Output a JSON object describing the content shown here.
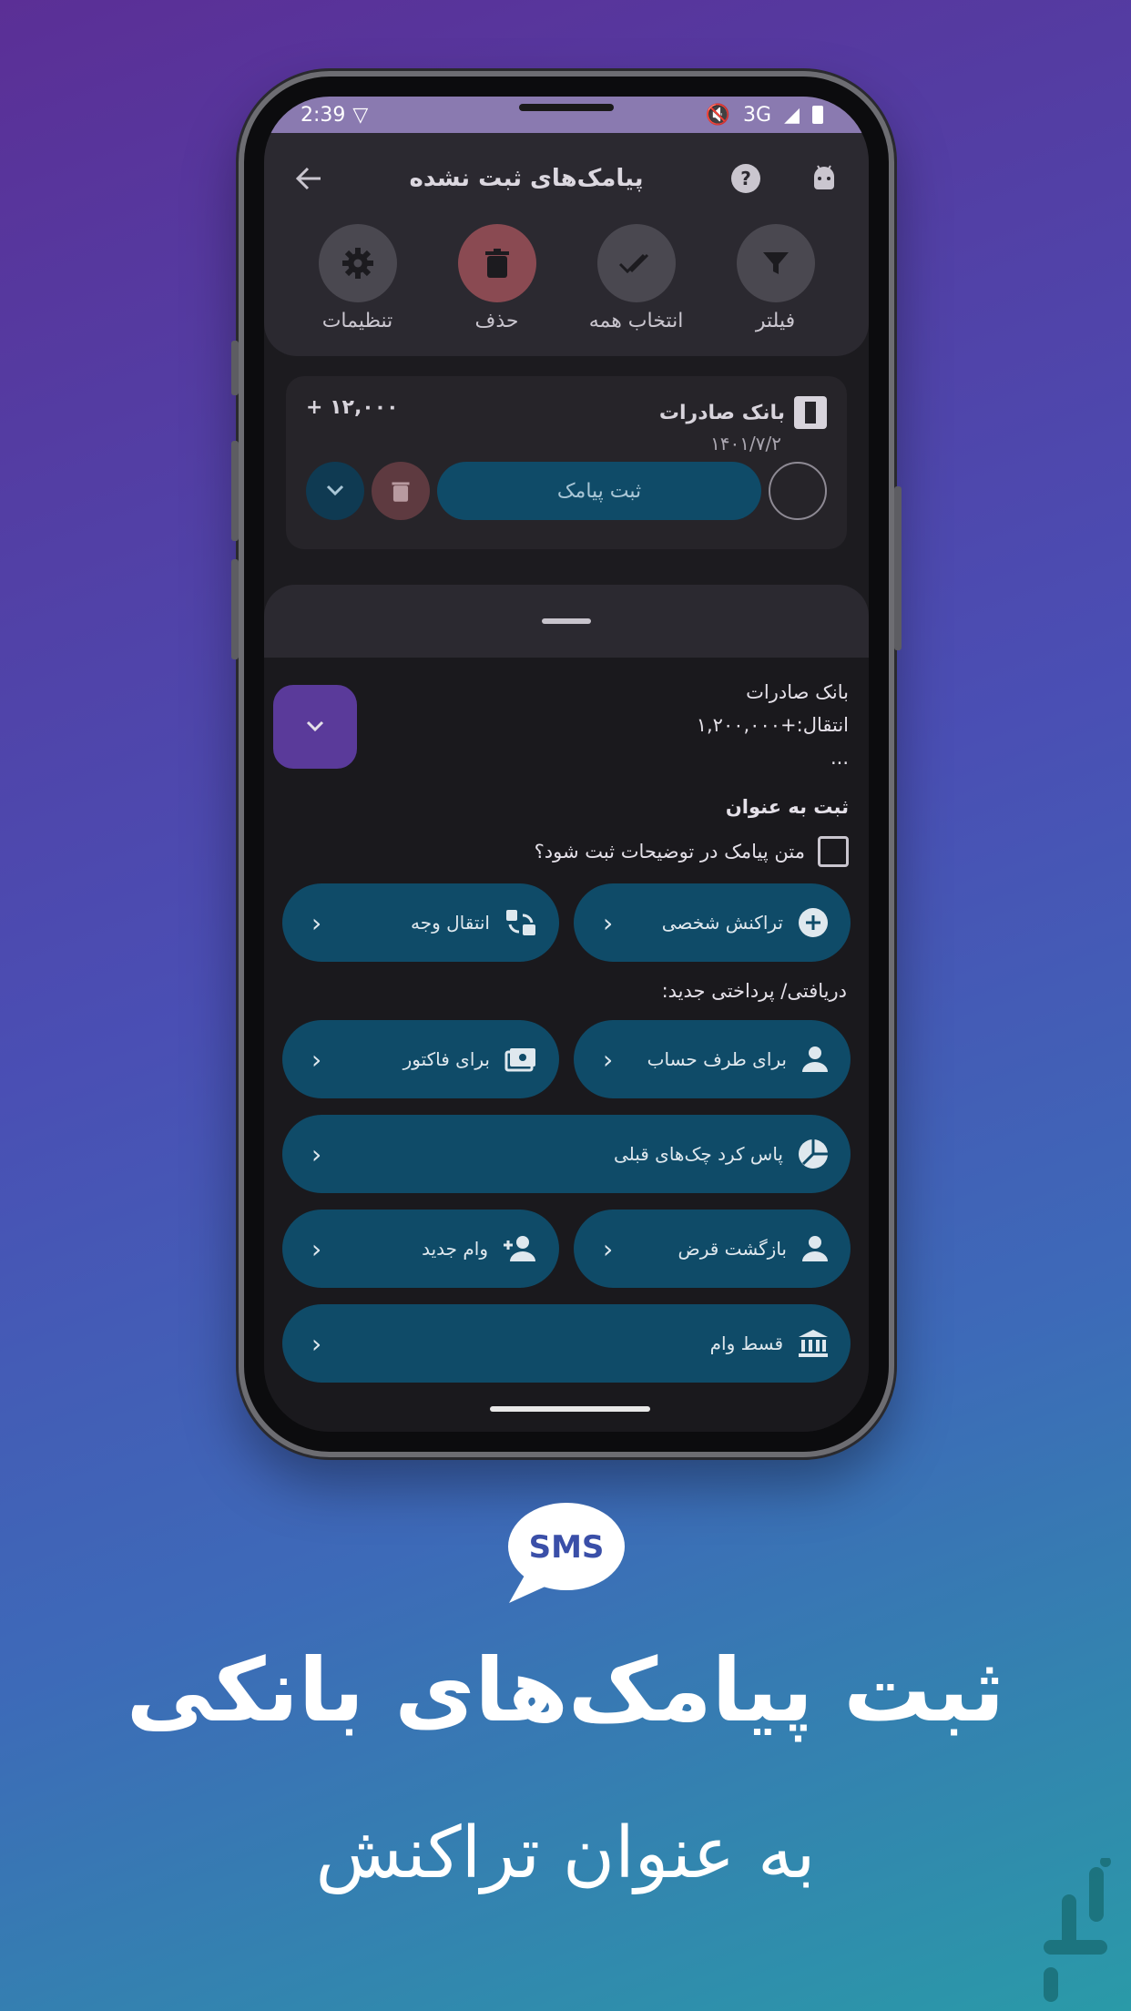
{
  "status_bar": {
    "time": "2:39",
    "network": "3G"
  },
  "app_bar": {
    "title": "پیامک‌های ثبت نشده",
    "back_icon": "arrow-left-icon",
    "help_icon": "help-icon",
    "bot_icon": "android-icon"
  },
  "actions": [
    {
      "label": "فیلتر",
      "icon": "filter-icon"
    },
    {
      "label": "انتخاب همه",
      "icon": "double-check-icon"
    },
    {
      "label": "حذف",
      "icon": "trash-icon"
    },
    {
      "label": "تنظیمات",
      "icon": "gear-icon"
    }
  ],
  "message_card": {
    "bank": "بانک صادرات",
    "date": "۱۴۰۱/۷/۲",
    "amount": "+ ۱۲,۰۰۰",
    "register_label": "ثبت پیامک"
  },
  "sheet": {
    "sms_lines": [
      "بانک صادرات",
      "انتقال:+۱,۲۰۰,۰۰۰",
      "..."
    ],
    "section_title": "ثبت به عنوان",
    "checkbox_label": "متن پیامک در توضیحات ثبت شود؟",
    "btn_personal": "تراکنش شخصی",
    "btn_transfer": "انتقال وجه",
    "subtitle": "دریافتی/ پرداختی جدید:",
    "btn_account": "برای طرف حساب",
    "btn_invoice": "برای فاکتور",
    "btn_checks": "پاس کرد چک‌های قبلی",
    "btn_loan_return": "بازگشت قرض",
    "btn_new_loan": "وام جدید",
    "btn_installment": "قسط وام"
  },
  "promo": {
    "bubble_text": "SMS",
    "headline": "ثبت پیامک‌های بانکی",
    "subline": "به عنوان تراکنش"
  },
  "colors": {
    "accent": "#0f4b68",
    "expand": "#5a3a9a",
    "delete": "#8a4a52"
  }
}
